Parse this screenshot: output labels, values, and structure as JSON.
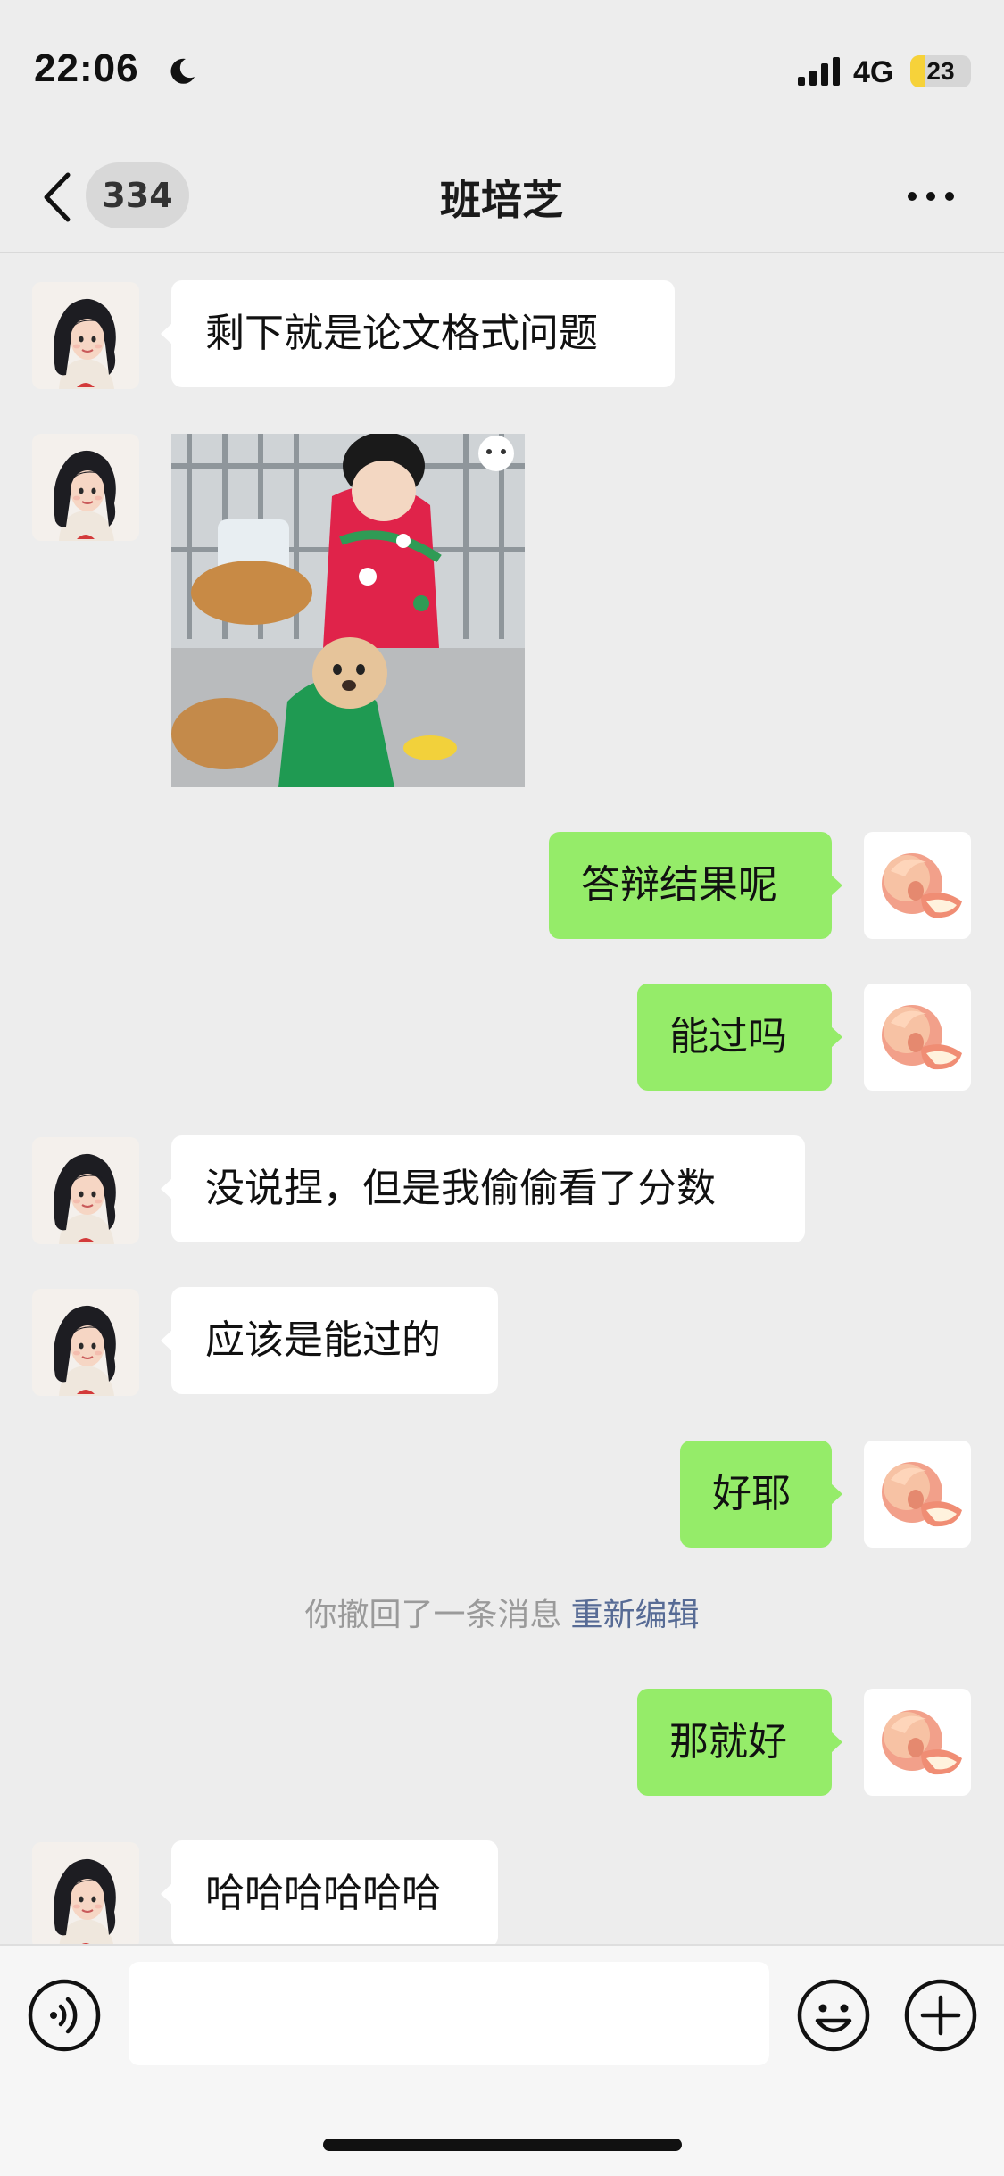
{
  "status_bar": {
    "time": "22:06",
    "network": "4G",
    "battery_level": "23",
    "icons": [
      "moon-icon",
      "signal-icon",
      "battery-icon"
    ]
  },
  "nav": {
    "unread_count": "334",
    "title": "班培芝",
    "icons": [
      "back-icon",
      "more-icon"
    ]
  },
  "messages": [
    {
      "side": "received",
      "text": "剩下就是论文格式问题"
    },
    {
      "side": "received",
      "type": "sticker",
      "description_icon": "sticker-image"
    },
    {
      "side": "sent",
      "text": "答辩结果呢"
    },
    {
      "side": "sent",
      "text": "能过吗"
    },
    {
      "side": "received",
      "text": "没说捏，但是我偷偷看了分数"
    },
    {
      "side": "received",
      "text": "应该是能过的"
    },
    {
      "side": "sent",
      "text": "好耶"
    },
    {
      "side": "sent",
      "text": "那就好"
    },
    {
      "side": "received",
      "text": "哈哈哈哈哈哈"
    }
  ],
  "system_note": {
    "text": "你撤回了一条消息",
    "link": "重新编辑"
  },
  "input_bar": {
    "value": "",
    "icons": [
      "voice-icon",
      "emoji-icon",
      "plus-icon"
    ]
  },
  "colors": {
    "background": "#ededed",
    "sent_bubble": "#95ec69",
    "received_bubble": "#ffffff",
    "link": "#576b95",
    "battery_fill": "#f6d23a"
  }
}
